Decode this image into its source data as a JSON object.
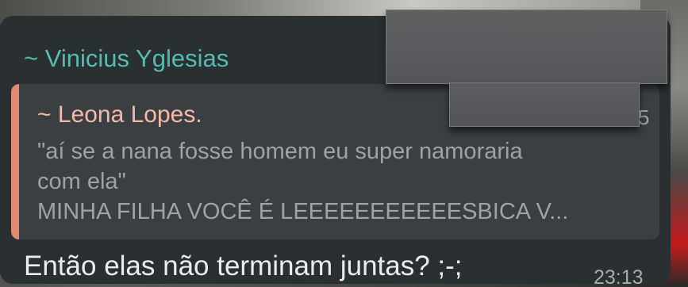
{
  "message": {
    "sender_name": "~ Vinicius Yglesias",
    "reply": {
      "author": "~ Leona Lopes.",
      "date_fragment": "5",
      "lines": [
        "\"aí se a nana fosse homem eu super namoraria",
        "com ela\"",
        "MINHA FILHA VOCÊ É LEEEEEEEEEEESBICA V..."
      ]
    },
    "text": "Então elas não terminam juntas? ;-;",
    "time": "23:13"
  },
  "colors": {
    "sender": "#53bdb1",
    "reply_author": "#f5b9a6",
    "reply_bar": "#e38a73",
    "bubble": "#2a2f32"
  }
}
